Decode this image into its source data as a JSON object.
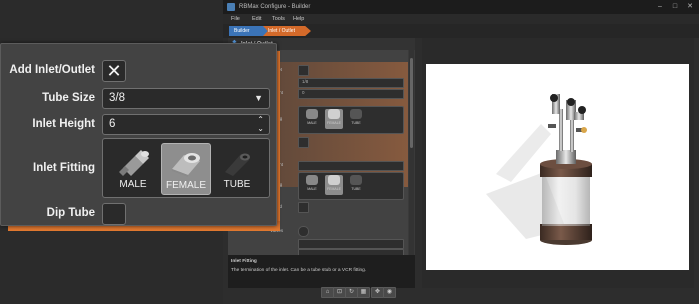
{
  "window": {
    "title": "RBMax Configure - Builder",
    "controls": [
      "–",
      "□",
      "✕"
    ]
  },
  "menu": [
    "File",
    "Edit",
    "Tools",
    "Help"
  ],
  "breadcrumb": [
    "Builder",
    "Inlet / Outlet"
  ],
  "panel": {
    "header": "Inlet / Outlet",
    "mini_labels": [
      "Outlet",
      "Size",
      "Height",
      "Fitting",
      "Tube",
      "Height",
      "Fitting",
      "Board",
      "Valves"
    ],
    "mini_fittings": [
      "MALE",
      "FEMALE",
      "TUBE"
    ],
    "mini_tube_size": "1/8",
    "mini_height": "0",
    "description_title": "Inlet Fitting",
    "description_text": "The termination of the inlet. Can be a tube stub or a VCR fitting."
  },
  "overlay": {
    "add_inlet_outlet": {
      "label": "Add Inlet/Outlet",
      "checked": true
    },
    "tube_size": {
      "label": "Tube Size",
      "value": "3/8"
    },
    "inlet_height": {
      "label": "Inlet Height",
      "value": "6"
    },
    "inlet_fitting": {
      "label": "Inlet Fitting",
      "options": [
        "MALE",
        "FEMALE",
        "TUBE"
      ],
      "selected": "FEMALE"
    },
    "dip_tube": {
      "label": "Dip Tube",
      "checked": false
    }
  },
  "colors": {
    "accent_orange": "#e07a30",
    "accent_blue": "#3b74b8"
  }
}
